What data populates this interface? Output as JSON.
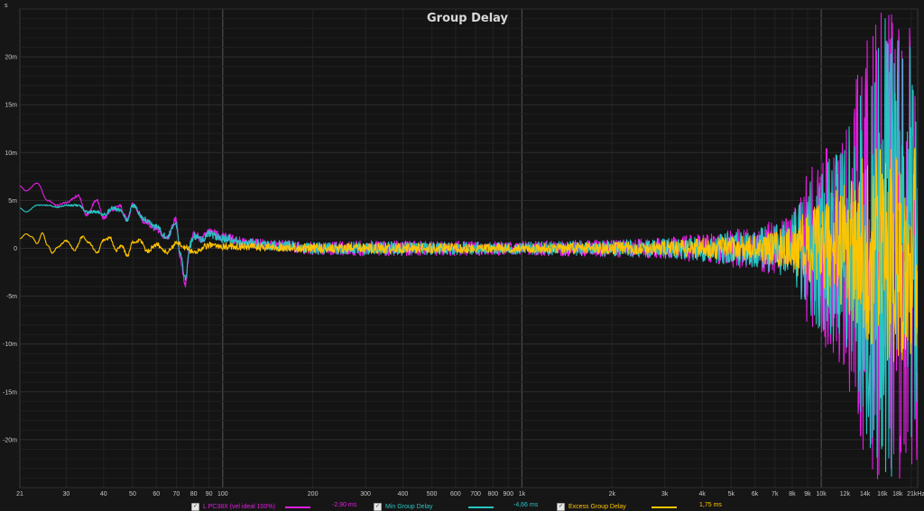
{
  "chart_data": {
    "type": "line",
    "title": "Group Delay",
    "yunit": "s",
    "xscale": "log",
    "xlim": [
      21,
      21000
    ],
    "ylim": [
      -0.025,
      0.025
    ],
    "x_ticks": [
      "21",
      "30",
      "40",
      "50",
      "60",
      "70",
      "80",
      "90",
      "100",
      "200",
      "300",
      "400",
      "500",
      "600",
      "700",
      "800",
      "900",
      "1k",
      "2k",
      "3k",
      "4k",
      "5k",
      "6k",
      "7k",
      "8k",
      "9k",
      "10k",
      "12k",
      "14k",
      "16k",
      "18k",
      "21kHz"
    ],
    "x_tick_values": [
      21,
      30,
      40,
      50,
      60,
      70,
      80,
      90,
      100,
      200,
      300,
      400,
      500,
      600,
      700,
      800,
      900,
      1000,
      2000,
      3000,
      4000,
      5000,
      6000,
      7000,
      8000,
      9000,
      10000,
      12000,
      14000,
      16000,
      18000,
      21000
    ],
    "y_ticks": [
      "20m",
      "15m",
      "10m",
      "5m",
      "0",
      "-5m",
      "-10m",
      "-15m",
      "-20m"
    ],
    "y_tick_values": [
      0.02,
      0.015,
      0.01,
      0.005,
      0,
      -0.005,
      -0.01,
      -0.015,
      -0.02
    ],
    "grid": true,
    "series": [
      {
        "name": "L PC38X (vel ideal 100%)",
        "value_label": "-2,90 ms",
        "color": "#e11ee1",
        "x": [
          21,
          22,
          24,
          26,
          28,
          30,
          33,
          35,
          38,
          40,
          43,
          45,
          48,
          50,
          55,
          60,
          65,
          70,
          72,
          75,
          78,
          80,
          85,
          90,
          100,
          120,
          150,
          200,
          300,
          500,
          1000,
          2000,
          4000,
          6000,
          8000,
          9000,
          10000,
          12000,
          14000,
          16000,
          18000,
          21000
        ],
        "y": [
          0.0065,
          0.006,
          0.0068,
          0.005,
          0.0045,
          0.0048,
          0.0055,
          0.0035,
          0.005,
          0.0032,
          0.004,
          0.0045,
          0.003,
          0.0045,
          0.0028,
          0.002,
          0.001,
          0.003,
          -0.001,
          -0.0038,
          0.0005,
          0.0015,
          0.001,
          0.0018,
          0.0012,
          0.0006,
          0.0003,
          0,
          0,
          0,
          0,
          0,
          0,
          0,
          0,
          0,
          0,
          0,
          0,
          0,
          0,
          0
        ],
        "noise_envelope_ms": [
          [
            21,
            0
          ],
          [
            100,
            0.5
          ],
          [
            300,
            0.9
          ],
          [
            1000,
            0.8
          ],
          [
            3000,
            1.2
          ],
          [
            6000,
            2.5
          ],
          [
            8000,
            4
          ],
          [
            9000,
            8
          ],
          [
            10000,
            10
          ],
          [
            12000,
            13
          ],
          [
            14000,
            22
          ],
          [
            16000,
            25
          ],
          [
            18000,
            25
          ],
          [
            21000,
            22
          ]
        ]
      },
      {
        "name": "Min Group Delay",
        "value_label": "-4,66 ms",
        "color": "#27c4c4",
        "x": [
          21,
          22,
          24,
          26,
          28,
          30,
          33,
          35,
          38,
          40,
          43,
          45,
          48,
          50,
          55,
          60,
          65,
          70,
          72,
          75,
          78,
          80,
          85,
          90,
          100,
          120,
          150,
          200,
          300,
          500,
          1000,
          2000,
          4000,
          6000,
          8000,
          9000,
          10000,
          12000,
          14000,
          16000,
          18000,
          21000
        ],
        "y": [
          0.0042,
          0.0038,
          0.0045,
          0.0045,
          0.0043,
          0.0045,
          0.0045,
          0.0038,
          0.0038,
          0.0035,
          0.0042,
          0.004,
          0.003,
          0.0045,
          0.003,
          0.0022,
          0.0012,
          0.0025,
          -0.0005,
          -0.003,
          0.0004,
          0.0012,
          0.0009,
          0.0015,
          0.001,
          0.0005,
          0.0003,
          0,
          0,
          0,
          0,
          0,
          0,
          0,
          0,
          0,
          0,
          0,
          0,
          0,
          0,
          0
        ],
        "noise_envelope_ms": [
          [
            21,
            0
          ],
          [
            100,
            0.5
          ],
          [
            300,
            0.8
          ],
          [
            1000,
            0.7
          ],
          [
            3000,
            1.1
          ],
          [
            6000,
            2.2
          ],
          [
            8000,
            3.5
          ],
          [
            9000,
            7
          ],
          [
            10000,
            9
          ],
          [
            12000,
            11
          ],
          [
            14000,
            20
          ],
          [
            16000,
            24
          ],
          [
            18000,
            24
          ],
          [
            21000,
            20
          ]
        ]
      },
      {
        "name": "Excess Group Delay",
        "value_label": "1,75 ms",
        "color": "#ffc400",
        "x": [
          21,
          22,
          23,
          24,
          25,
          26,
          27,
          28,
          30,
          32,
          34,
          36,
          38,
          40,
          42,
          44,
          46,
          48,
          50,
          53,
          56,
          60,
          65,
          70,
          75,
          80,
          90,
          100,
          150,
          200,
          300,
          500,
          1000,
          2000,
          4000,
          6000,
          8000,
          10000,
          12000,
          14000,
          16000,
          18000,
          21000
        ],
        "y": [
          0.001,
          0.0015,
          0.0012,
          0.0005,
          0.0016,
          0.0003,
          -0.0005,
          0.0001,
          0.0008,
          -0.0002,
          0.0012,
          0.0005,
          -0.0005,
          0.0008,
          0.0011,
          -0.0002,
          0.0003,
          -0.0008,
          0.0006,
          0.0008,
          -0.0003,
          0.0004,
          -0.0004,
          0.0005,
          0.0001,
          -0.0004,
          0.0003,
          0.0002,
          0.0001,
          0,
          0,
          0,
          0,
          0,
          0,
          0,
          0,
          0,
          0,
          0,
          0,
          0,
          0
        ],
        "noise_envelope_ms": [
          [
            21,
            0
          ],
          [
            100,
            0.4
          ],
          [
            300,
            0.6
          ],
          [
            1000,
            0.5
          ],
          [
            3000,
            0.8
          ],
          [
            6000,
            1.6
          ],
          [
            8000,
            2.5
          ],
          [
            9000,
            4
          ],
          [
            10000,
            5.5
          ],
          [
            12000,
            7
          ],
          [
            14000,
            10
          ],
          [
            16000,
            12
          ],
          [
            18000,
            12
          ],
          [
            21000,
            11
          ]
        ]
      }
    ]
  },
  "legend": [
    {
      "checked": true,
      "label": "L PC38X (vel ideal 100%)",
      "value": "-2,90 ms"
    },
    {
      "checked": true,
      "label": "Min Group Delay",
      "value": "-4,66 ms"
    },
    {
      "checked": true,
      "label": "Excess Group Delay",
      "value": "1,75 ms"
    }
  ]
}
